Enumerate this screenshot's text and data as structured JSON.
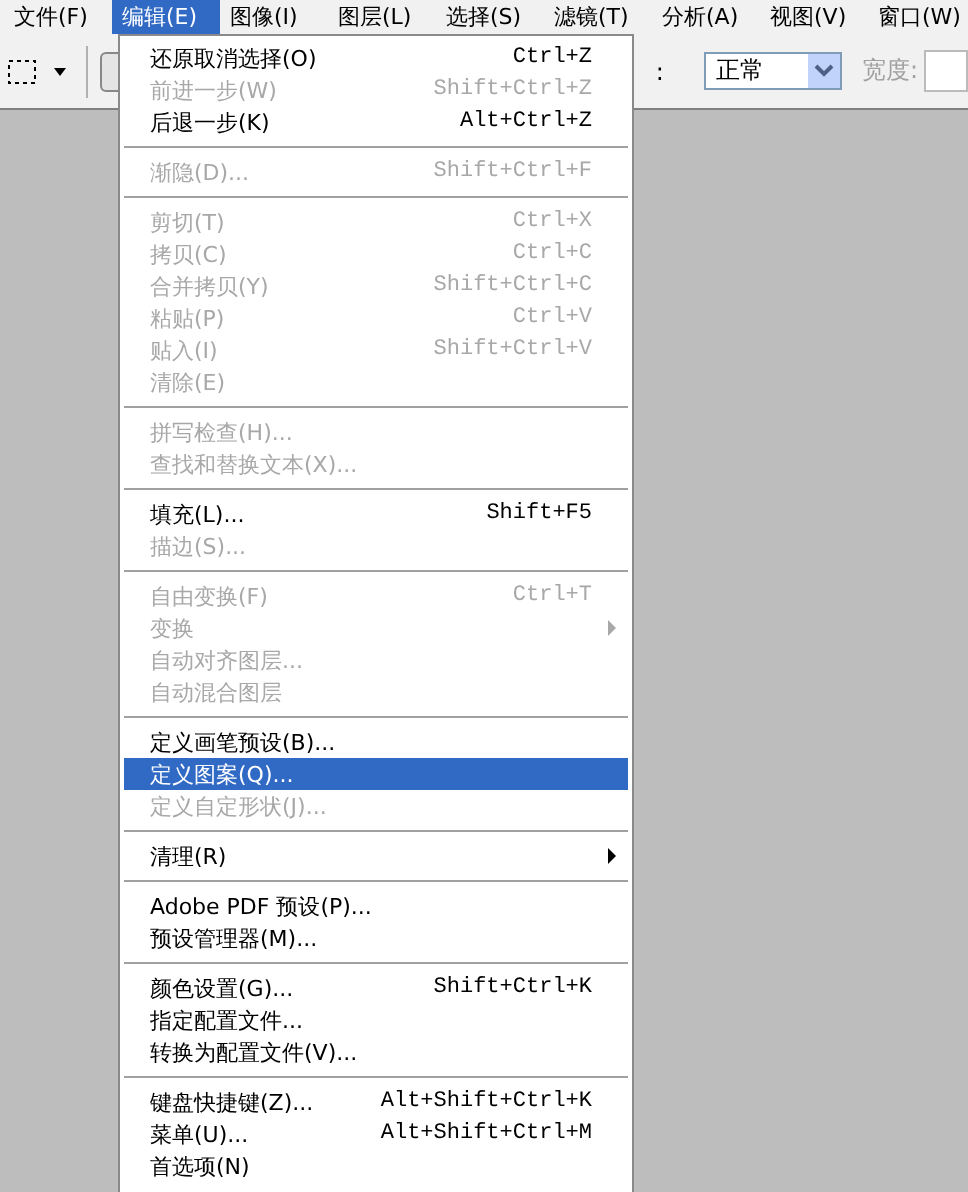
{
  "menubar": [
    {
      "label": "文件(F)",
      "selected": false
    },
    {
      "label": "编辑(E)",
      "selected": true
    },
    {
      "label": "图像(I)",
      "selected": false
    },
    {
      "label": "图层(L)",
      "selected": false
    },
    {
      "label": "选择(S)",
      "selected": false
    },
    {
      "label": "滤镜(T)",
      "selected": false
    },
    {
      "label": "分析(A)",
      "selected": false
    },
    {
      "label": "视图(V)",
      "selected": false
    },
    {
      "label": "窗口(W)",
      "selected": false
    }
  ],
  "toolbar": {
    "style_label": ":",
    "mode": "正常",
    "width_label": "宽度:"
  },
  "menu": {
    "groups": [
      [
        {
          "label": "还原取消选择(O)",
          "shortcut": "Ctrl+Z",
          "disabled": false,
          "selected": false
        },
        {
          "label": "前进一步(W)",
          "shortcut": "Shift+Ctrl+Z",
          "disabled": true,
          "selected": false
        },
        {
          "label": "后退一步(K)",
          "shortcut": "Alt+Ctrl+Z",
          "disabled": false,
          "selected": false
        }
      ],
      [
        {
          "label": "渐隐(D)...",
          "shortcut": "Shift+Ctrl+F",
          "disabled": true,
          "selected": false
        }
      ],
      [
        {
          "label": "剪切(T)",
          "shortcut": "Ctrl+X",
          "disabled": true,
          "selected": false
        },
        {
          "label": "拷贝(C)",
          "shortcut": "Ctrl+C",
          "disabled": true,
          "selected": false
        },
        {
          "label": "合并拷贝(Y)",
          "shortcut": "Shift+Ctrl+C",
          "disabled": true,
          "selected": false
        },
        {
          "label": "粘贴(P)",
          "shortcut": "Ctrl+V",
          "disabled": true,
          "selected": false
        },
        {
          "label": "贴入(I)",
          "shortcut": "Shift+Ctrl+V",
          "disabled": true,
          "selected": false
        },
        {
          "label": "清除(E)",
          "disabled": true,
          "selected": false
        }
      ],
      [
        {
          "label": "拼写检查(H)...",
          "disabled": true,
          "selected": false
        },
        {
          "label": "查找和替换文本(X)...",
          "disabled": true,
          "selected": false
        }
      ],
      [
        {
          "label": "填充(L)...",
          "shortcut": "Shift+F5",
          "disabled": false,
          "selected": false
        },
        {
          "label": "描边(S)...",
          "disabled": true,
          "selected": false
        }
      ],
      [
        {
          "label": "自由变换(F)",
          "shortcut": "Ctrl+T",
          "disabled": true,
          "selected": false
        },
        {
          "label": "变换",
          "disabled": true,
          "selected": false,
          "submenu": true
        },
        {
          "label": "自动对齐图层...",
          "disabled": true,
          "selected": false
        },
        {
          "label": "自动混合图层",
          "disabled": true,
          "selected": false
        }
      ],
      [
        {
          "label": "定义画笔预设(B)...",
          "disabled": false,
          "selected": false
        },
        {
          "label": "定义图案(Q)...",
          "disabled": false,
          "selected": true
        },
        {
          "label": "定义自定形状(J)...",
          "disabled": true,
          "selected": false
        }
      ],
      [
        {
          "label": "清理(R)",
          "disabled": false,
          "selected": false,
          "submenu": true
        }
      ],
      [
        {
          "label": "Adobe PDF 预设(P)...",
          "disabled": false,
          "selected": false
        },
        {
          "label": "预设管理器(M)...",
          "disabled": false,
          "selected": false
        }
      ],
      [
        {
          "label": "颜色设置(G)...",
          "shortcut": "Shift+Ctrl+K",
          "disabled": false,
          "selected": false
        },
        {
          "label": "指定配置文件...",
          "disabled": false,
          "selected": false
        },
        {
          "label": "转换为配置文件(V)...",
          "disabled": false,
          "selected": false
        }
      ],
      [
        {
          "label": "键盘快捷键(Z)...",
          "shortcut": "Alt+Shift+Ctrl+K",
          "disabled": false,
          "selected": false
        },
        {
          "label": "菜单(U)...",
          "shortcut": "Alt+Shift+Ctrl+M",
          "disabled": false,
          "selected": false
        },
        {
          "label": "首选项(N)",
          "disabled": false,
          "selected": false
        }
      ]
    ]
  }
}
